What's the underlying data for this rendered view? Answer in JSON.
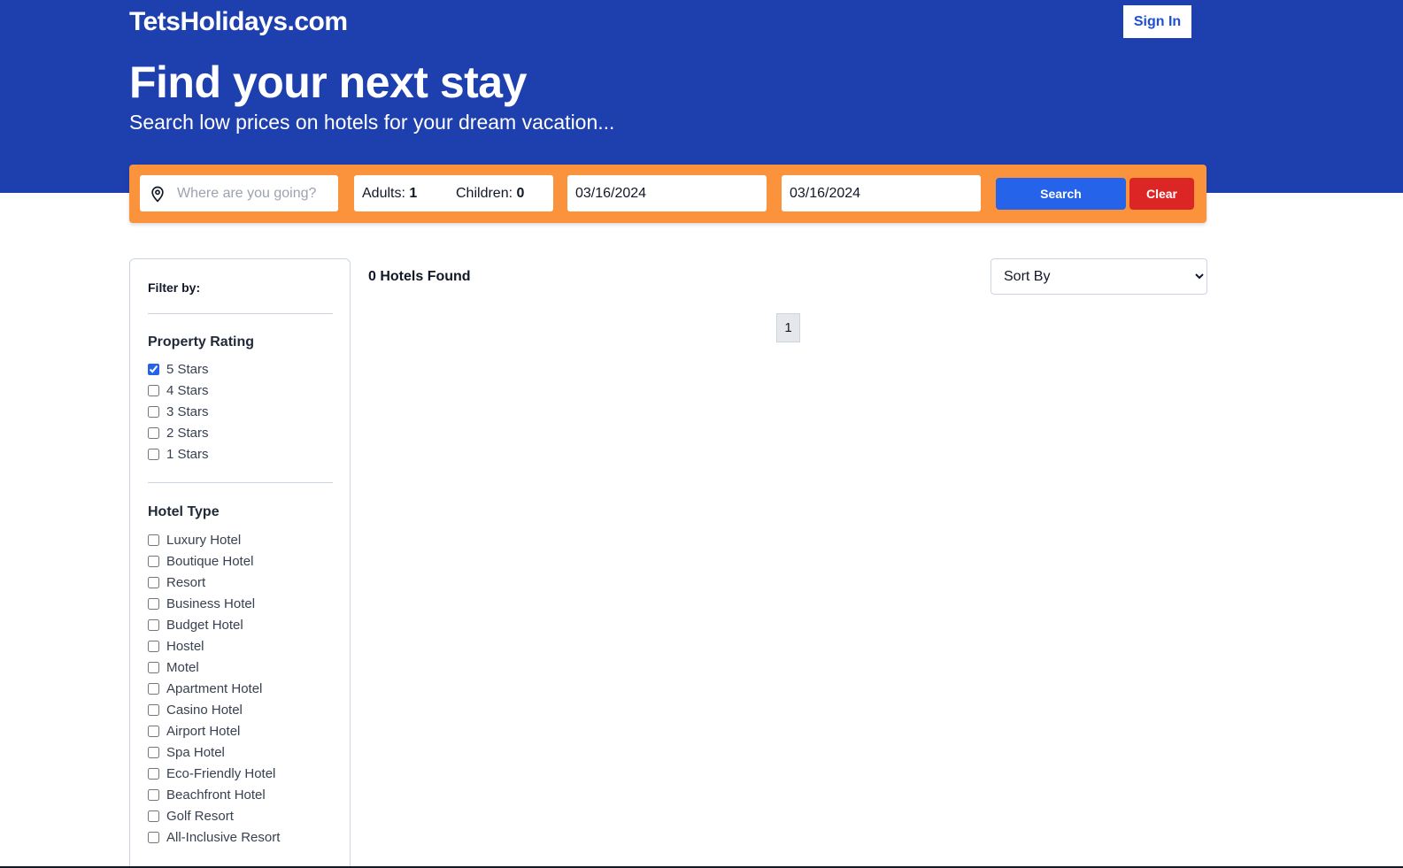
{
  "header": {
    "brand": "TetsHolidays.com",
    "sign_in": "Sign In",
    "title": "Find your next stay",
    "subtitle": "Search low prices on hotels for your dream vacation..."
  },
  "search": {
    "destination_placeholder": "Where are you going?",
    "adults_label": "Adults:",
    "adults_value": "1",
    "children_label": "Children:",
    "children_value": "0",
    "check_in": "03/16/2024",
    "check_out": "03/16/2024",
    "search_button": "Search",
    "clear_button": "Clear"
  },
  "filters": {
    "heading": "Filter by:",
    "property_rating": {
      "title": "Property Rating",
      "options": [
        {
          "label": "5 Stars",
          "checked": true
        },
        {
          "label": "4 Stars",
          "checked": false
        },
        {
          "label": "3 Stars",
          "checked": false
        },
        {
          "label": "2 Stars",
          "checked": false
        },
        {
          "label": "1 Stars",
          "checked": false
        }
      ]
    },
    "hotel_type": {
      "title": "Hotel Type",
      "options": [
        {
          "label": "Luxury Hotel",
          "checked": false
        },
        {
          "label": "Boutique Hotel",
          "checked": false
        },
        {
          "label": "Resort",
          "checked": false
        },
        {
          "label": "Business Hotel",
          "checked": false
        },
        {
          "label": "Budget Hotel",
          "checked": false
        },
        {
          "label": "Hostel",
          "checked": false
        },
        {
          "label": "Motel",
          "checked": false
        },
        {
          "label": "Apartment Hotel",
          "checked": false
        },
        {
          "label": "Casino Hotel",
          "checked": false
        },
        {
          "label": "Airport Hotel",
          "checked": false
        },
        {
          "label": "Spa Hotel",
          "checked": false
        },
        {
          "label": "Eco-Friendly Hotel",
          "checked": false
        },
        {
          "label": "Beachfront Hotel",
          "checked": false
        },
        {
          "label": "Golf Resort",
          "checked": false
        },
        {
          "label": "All-Inclusive Resort",
          "checked": false
        }
      ]
    }
  },
  "results": {
    "count_text": "0 Hotels Found",
    "sort_selected": "Sort By",
    "pages": [
      "1"
    ]
  }
}
